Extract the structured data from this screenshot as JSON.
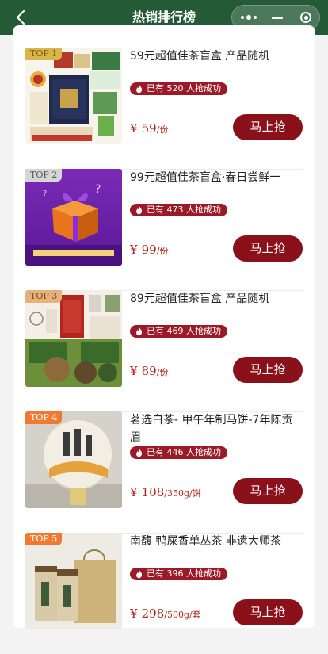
{
  "header": {
    "title": "热销排行榜"
  },
  "colors": {
    "header_bg": "#245a36",
    "accent": "#8a1019",
    "badge": "#9c1a28",
    "price": "#b5241d"
  },
  "items": [
    {
      "rank": "TOP 1",
      "name": "59元超值佳茶盲盒 产品随机",
      "sold": "已有 520 人抢成功",
      "currency": "¥",
      "price": "59",
      "unit": "/份",
      "button": "马上抢",
      "rank_color": "#d8b64a"
    },
    {
      "rank": "TOP 2",
      "name": "99元超值佳茶盲盒·春日尝鲜一",
      "sold": "已有 473 人抢成功",
      "currency": "¥",
      "price": "99",
      "unit": "/份",
      "button": "马上抢",
      "rank_color": "#d6d6d6"
    },
    {
      "rank": "TOP 3",
      "name": "89元超值佳茶盲盒 产品随机",
      "sold": "已有 469 人抢成功",
      "currency": "¥",
      "price": "89",
      "unit": "/份",
      "button": "马上抢",
      "rank_color": "#e4b27a"
    },
    {
      "rank": "TOP 4",
      "name": "茗选白茶- 甲午年制马饼-7年陈贡眉",
      "sold": "已有 446 人抢成功",
      "currency": "¥",
      "price": "108",
      "unit": "/350g/饼",
      "button": "马上抢",
      "rank_color": "#f07a32"
    },
    {
      "rank": "TOP 5",
      "name": "南馥 鸭屎香单丛茶 非遗大师茶",
      "sold": "已有 396 人抢成功",
      "currency": "¥",
      "price": "298",
      "unit": "/500g/套",
      "button": "马上抢",
      "rank_color": "#f07a32"
    }
  ]
}
